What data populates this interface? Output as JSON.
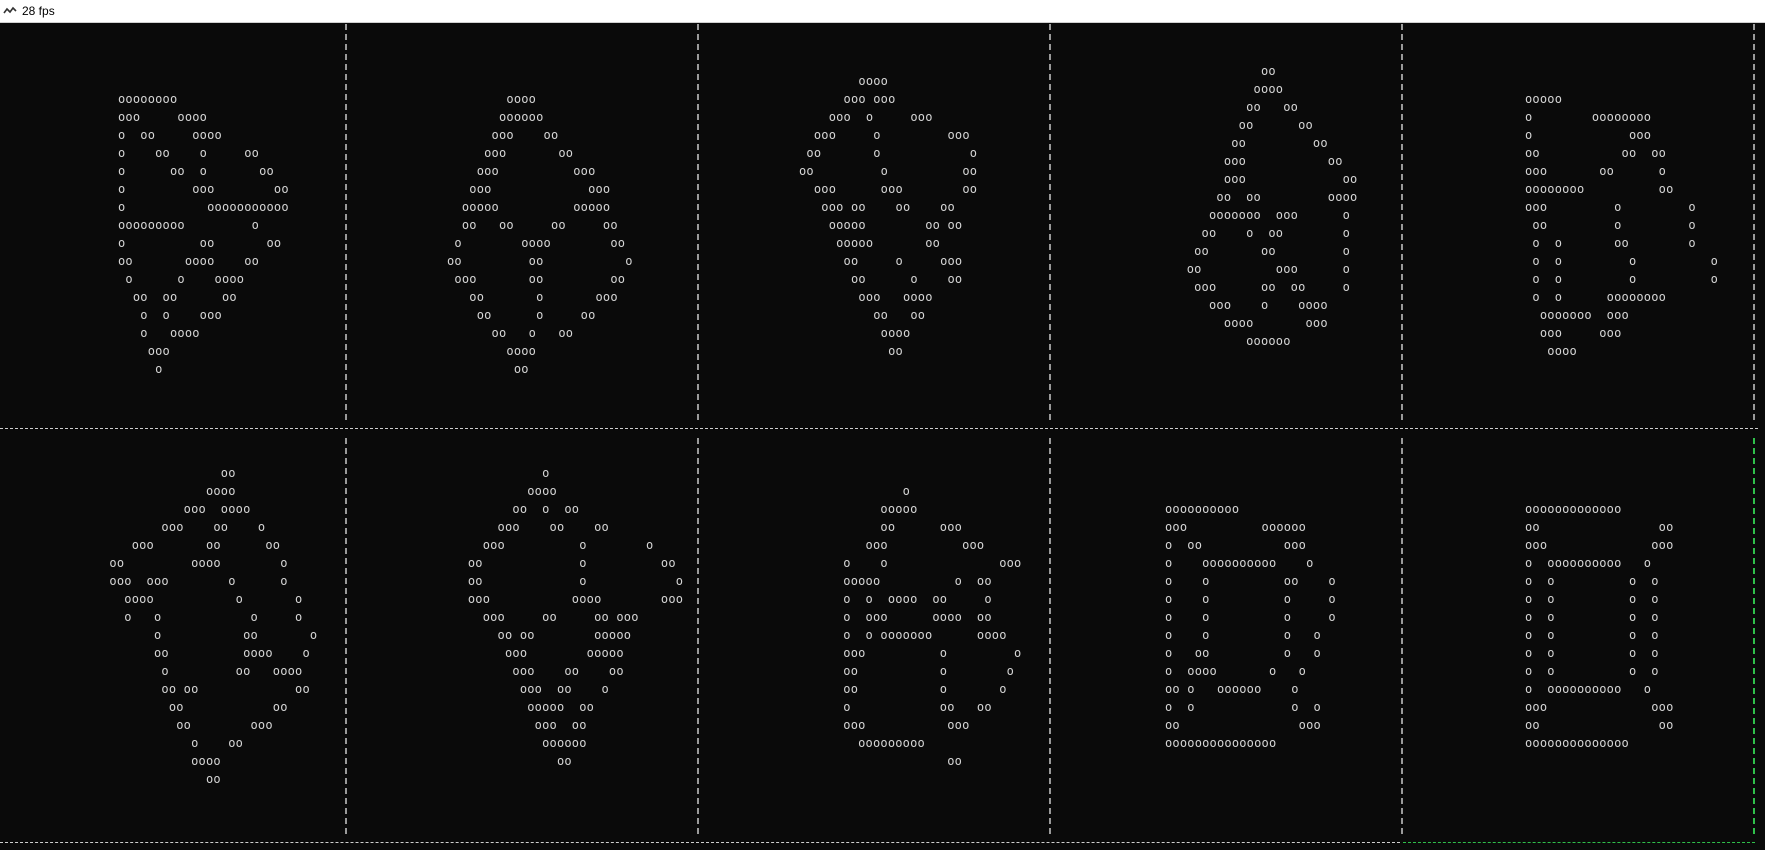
{
  "window": {
    "title": "28 fps",
    "icon": "app-icon"
  },
  "colors": {
    "background": "#0a0a0a",
    "glyph": "#d6d6d6",
    "separator": "#9a9a9a",
    "focus": "#2fbf4a"
  },
  "frames": [
    {
      "label": "frame-1",
      "lines": [
        "",
        "",
        "oooooooo",
        "ooo     oooo",
        "o  oo     oooo",
        "o    oo    o     oo",
        "o      oo  o       oo",
        "o         ooo        oo",
        "o           ooooooooooo",
        "ooooooooo         o",
        "o          oo       oo",
        "oo       oooo    oo",
        " o      o    oooo",
        "  oo  oo      oo",
        "   o  o    ooo",
        "   o   oooo",
        "    ooo",
        "     o"
      ]
    },
    {
      "label": "frame-2",
      "lines": [
        "",
        "",
        "        oooo",
        "       oooooo",
        "      ooo    oo",
        "     ooo       oo",
        "    ooo          ooo",
        "   ooo             ooo",
        "  ooooo          ooooo",
        "  oo   oo     oo     oo",
        " o        oooo        oo",
        "oo         oo           o",
        " ooo       oo         oo",
        "   oo       o       ooo",
        "    oo      o     oo",
        "      oo   o   oo",
        "        oooo",
        "         oo"
      ]
    },
    {
      "label": "frame-3",
      "lines": [
        "",
        "        oooo",
        "      ooo ooo",
        "    ooo  o     ooo",
        "  ooo     o         ooo",
        " oo       o            o",
        "oo         o          oo",
        "  ooo      ooo        oo",
        "   ooo oo    oo    oo",
        "    ooooo        oo oo",
        "     ooooo       oo",
        "      oo     o     ooo",
        "       oo      o    oo",
        "        ooo   oooo",
        "          oo   oo",
        "           oooo",
        "            oo"
      ]
    },
    {
      "label": "frame-4",
      "lines": [
        "              oo",
        "             oooo",
        "            oo   oo",
        "           oo      oo",
        "          oo         oo",
        "         ooo           oo",
        "         ooo             oo",
        "        oo  oo         oooo",
        "       ooooooo  ooo      o",
        "      oo    o  oo        o",
        "     oo       oo         o",
        "    oo          ooo      o",
        "     ooo      oo  oo     o",
        "       ooo    o    oooo",
        "         oooo       ooo",
        "            oooooo"
      ]
    },
    {
      "label": "frame-5",
      "lines": [
        "",
        "ooooo",
        "o        oooooooo",
        "o             ooo",
        "oo           oo  oo",
        "ooo       oo      o",
        "oooooooo          oo",
        "ooo         o         o",
        " oo         o         o",
        " o  o       oo        o",
        " o  o         o          o",
        " o  o         o          o",
        " o  o      oooooooo",
        "  ooooooo  ooo",
        "  ooo     ooo",
        "   oooo"
      ]
    },
    {
      "label": "frame-6",
      "lines": [
        "                oo",
        "              oooo",
        "           ooo  oooo",
        "        ooo    oo    o",
        "    ooo       oo      oo",
        " oo         oooo        o",
        " ooo  ooo        o      o",
        "   oooo           o       o",
        "   o   o            o     o",
        "       o           oo       o",
        "       oo          oooo    o",
        "        o         oo   oooo",
        "        oo oo             oo",
        "         oo            oo",
        "          oo        ooo",
        "            o    oo",
        "            oooo",
        "              oo"
      ]
    },
    {
      "label": "frame-7",
      "lines": [
        "            o",
        "          oooo",
        "        oo  o  oo",
        "      ooo    oo    oo",
        "    ooo          o        o",
        "  oo             o          oo",
        "  oo             o            o",
        "  ooo           oooo        ooo",
        "    ooo     oo     oo ooo",
        "      oo oo        ooooo",
        "       ooo        ooooo",
        "        ooo    oo    oo",
        "         ooo  oo    o",
        "          ooooo  oo",
        "           ooo  oo",
        "            oooooo",
        "              oo"
      ]
    },
    {
      "label": "frame-8",
      "lines": [
        "",
        "           o",
        "        ooooo",
        "        oo      ooo",
        "      ooo          ooo",
        "   o    o               ooo",
        "   ooooo          o  oo",
        "   o  o  oooo  oo     o",
        "   o  ooo      oooo  oo",
        "   o  o ooooooo      oooo",
        "   ooo          o         o",
        "   oo           o        o",
        "   oo           o       o",
        "   o            oo   oo",
        "   ooo           ooo",
        "     ooooooooo",
        "                 oo"
      ]
    },
    {
      "label": "frame-9",
      "lines": [
        "",
        "",
        "oooooooooo",
        "ooo          oooooo",
        "o  oo           ooo",
        "o    oooooooooo    o",
        "o    o          oo    o",
        "o    o          o     o",
        "o    o          o     o",
        "o    o          o   o",
        "o   oo          o   o",
        "o  oooo       o   o",
        "oo o   oooooo    o",
        "o  o             o  o",
        "oo                ooo",
        "ooooooooooooooo"
      ]
    },
    {
      "label": "frame-10",
      "lines": [
        "",
        "",
        "ooooooooooooo",
        "oo                oo",
        "ooo              ooo",
        "o  oooooooooo   o",
        "o  o          o  o",
        "o  o          o  o",
        "o  o          o  o",
        "o  o          o  o",
        "o  o          o  o",
        "o  o          o  o",
        "o  oooooooooo   o",
        "ooo              ooo",
        "oo                oo",
        "oooooooooooooo"
      ]
    }
  ]
}
